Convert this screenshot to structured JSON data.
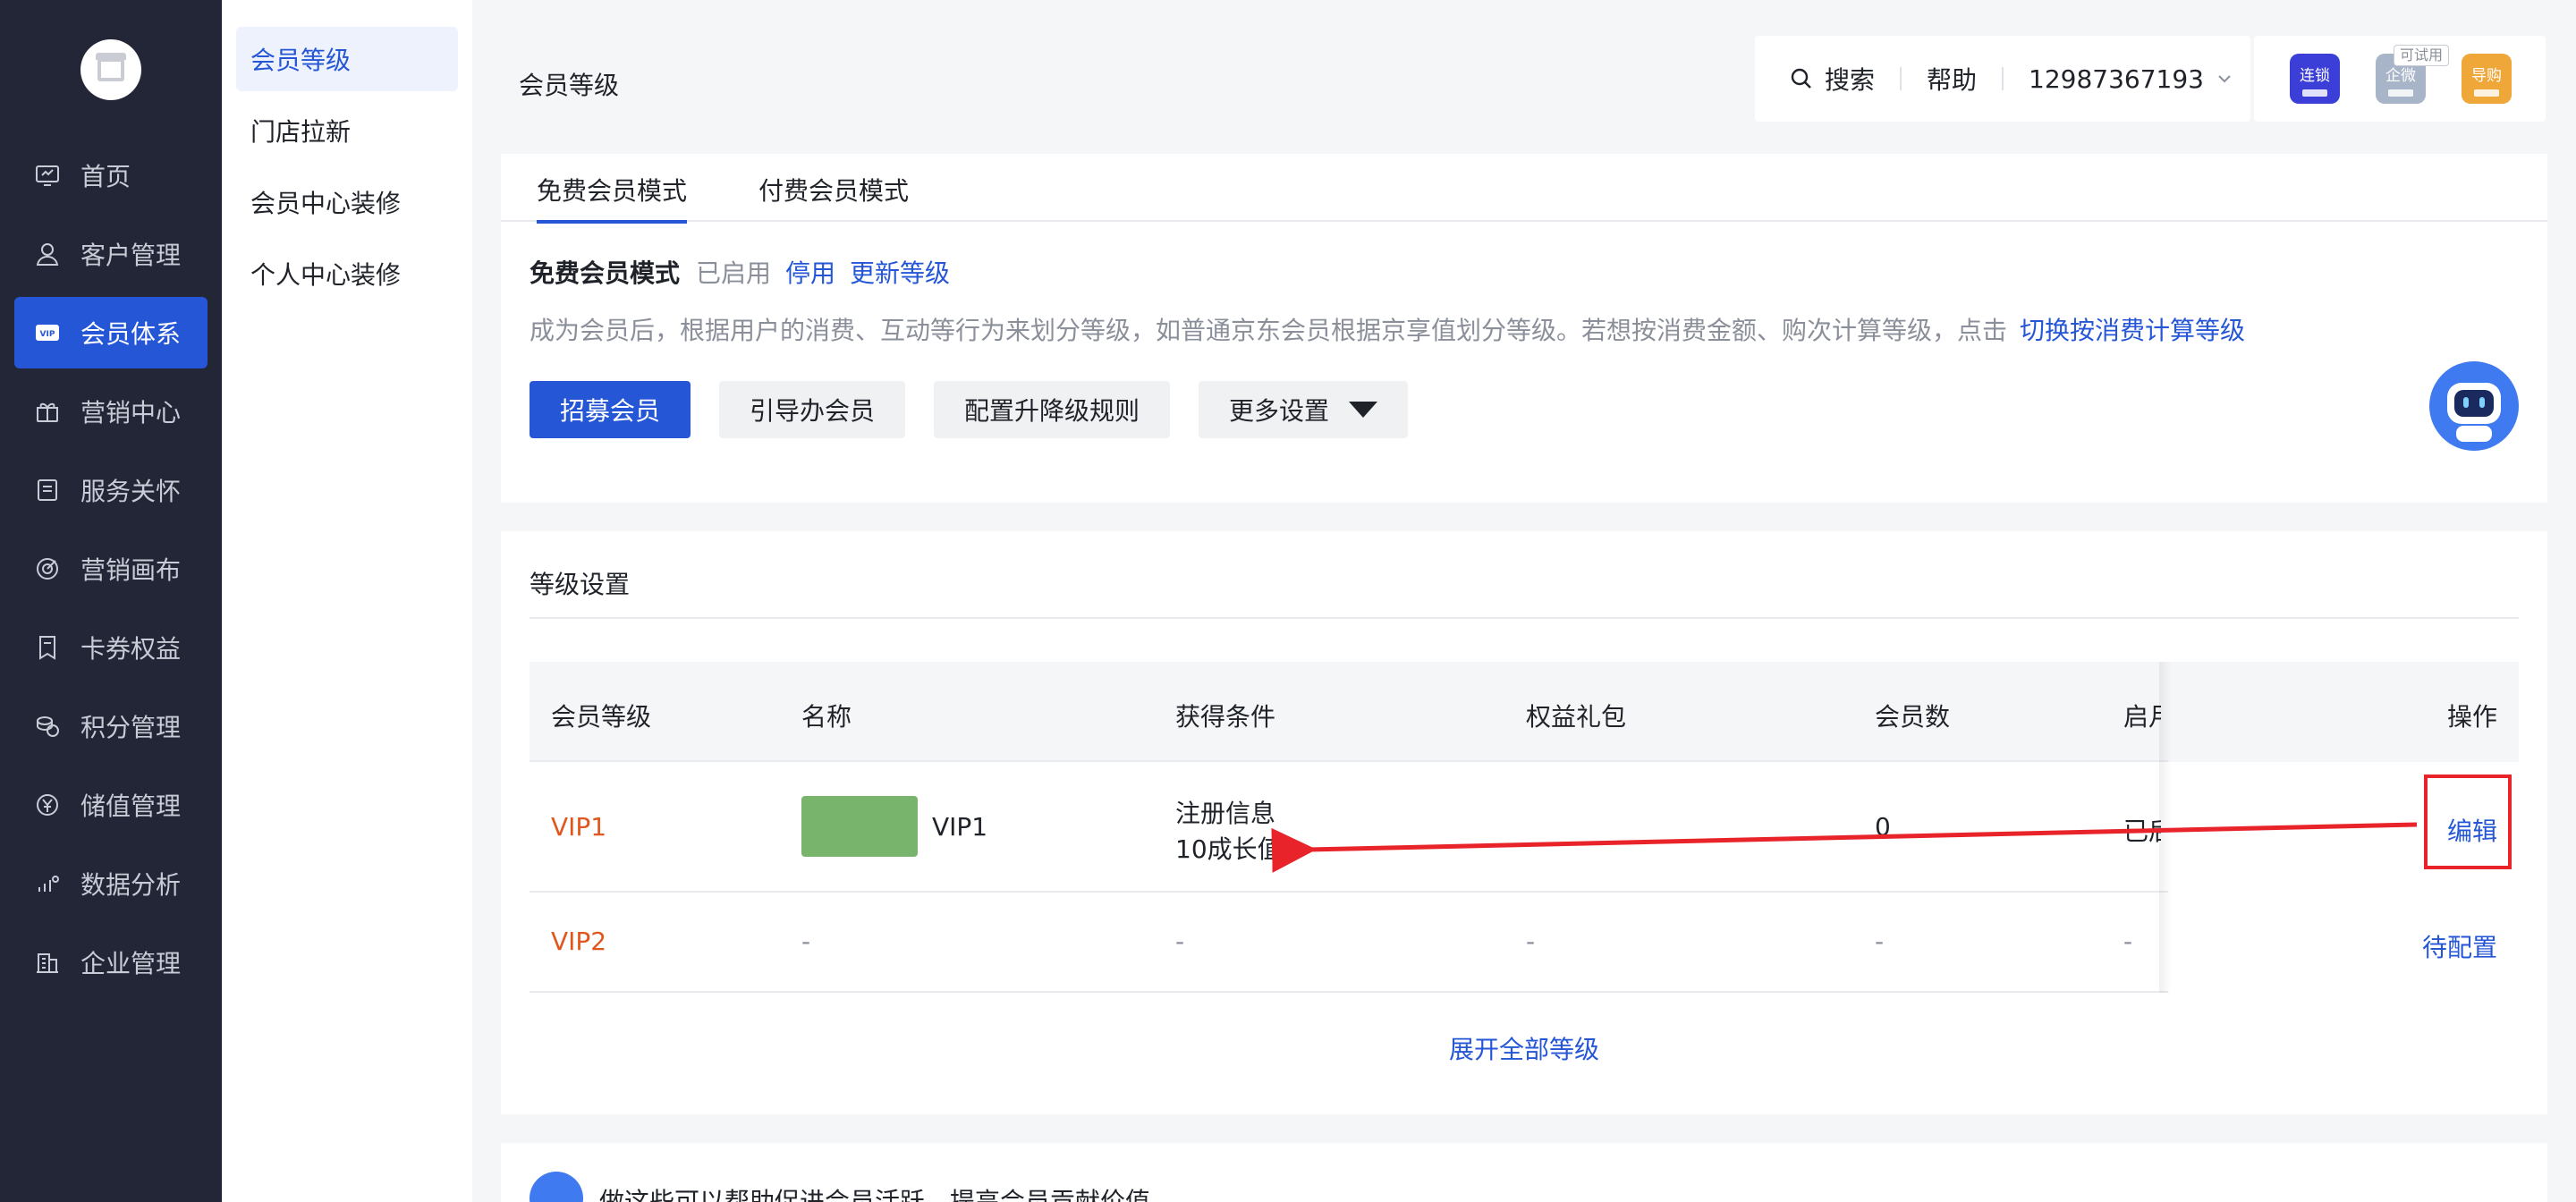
{
  "nav": {
    "items": [
      {
        "label": "首页",
        "icon": "dashboard-icon",
        "active": false
      },
      {
        "label": "客户管理",
        "icon": "user-icon",
        "active": false
      },
      {
        "label": "会员体系",
        "icon": "vip-icon",
        "active": true
      },
      {
        "label": "营销中心",
        "icon": "gift-icon",
        "active": false
      },
      {
        "label": "服务关怀",
        "icon": "care-icon",
        "active": false
      },
      {
        "label": "营销画布",
        "icon": "target-icon",
        "active": false
      },
      {
        "label": "卡券权益",
        "icon": "coupon-icon",
        "active": false
      },
      {
        "label": "积分管理",
        "icon": "points-icon",
        "active": false
      },
      {
        "label": "储值管理",
        "icon": "yen-icon",
        "active": false
      },
      {
        "label": "数据分析",
        "icon": "chart-icon",
        "active": false
      },
      {
        "label": "企业管理",
        "icon": "building-icon",
        "active": false
      }
    ]
  },
  "submenu": {
    "items": [
      {
        "label": "会员等级",
        "active": true
      },
      {
        "label": "门店拉新",
        "active": false
      },
      {
        "label": "会员中心装修",
        "active": false
      },
      {
        "label": "个人中心装修",
        "active": false
      }
    ]
  },
  "header": {
    "title": "会员等级",
    "search_label": "搜索",
    "help_label": "帮助",
    "account": "12987367193",
    "apps": [
      {
        "label": "连锁",
        "color": "#3b3fd8"
      },
      {
        "label": "企微",
        "color": "#a8b4c8"
      },
      {
        "label": "导购",
        "color": "#f0a73a"
      }
    ],
    "trial_badge": "可试用"
  },
  "mode": {
    "tabs": [
      "免费会员模式",
      "付费会员模式"
    ],
    "title": "免费会员模式",
    "status": "已启用",
    "disable_link": "停用",
    "update_link": "更新等级",
    "description": "成为会员后，根据用户的消费、互动等行为来划分等级，如普通京东会员根据京享值划分等级。若想按消费金额、购次计算等级，点击",
    "switch_link": "切换按消费计算等级",
    "buttons": {
      "recruit": "招募会员",
      "guide": "引导办会员",
      "rules": "配置升降级规则",
      "more": "更多设置"
    }
  },
  "levels": {
    "section_title": "等级设置",
    "columns": [
      "会员等级",
      "名称",
      "获得条件",
      "权益礼包",
      "会员数",
      "启月",
      "操作"
    ],
    "rows": [
      {
        "level": "VIP1",
        "name": "VIP1",
        "condition_1": "注册信息",
        "condition_2": "10成长值",
        "gift": "",
        "members": "0",
        "enabled": "已后",
        "action": "编辑"
      },
      {
        "level": "VIP2",
        "name": "-",
        "condition_1": "-",
        "gift": "-",
        "members": "-",
        "enabled": "-",
        "action": "待配置"
      }
    ],
    "expand_label": "展开全部等级",
    "swatch_color": "#79b46c"
  },
  "tips": {
    "text": "做这些可以帮助促进会员活跃，提高会员贡献价值"
  },
  "colors": {
    "accent": "#2456d6",
    "nav_bg": "#222637",
    "level_text": "#e0571e",
    "annotation": "#e8232a"
  }
}
